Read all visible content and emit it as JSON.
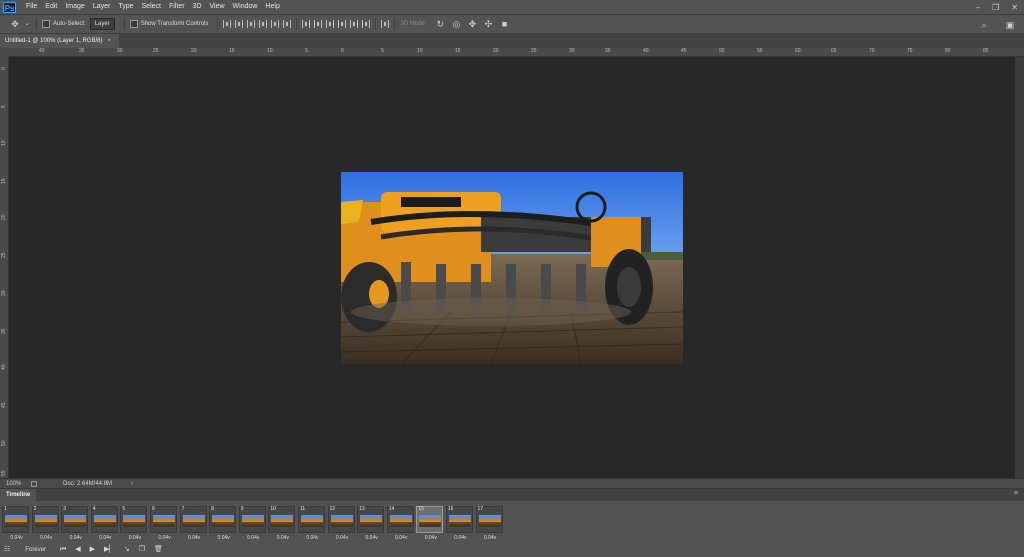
{
  "app": {
    "logo": "Ps"
  },
  "menu": [
    "File",
    "Edit",
    "Image",
    "Layer",
    "Type",
    "Select",
    "Filter",
    "3D",
    "View",
    "Window",
    "Help"
  ],
  "window_controls": [
    "minimize-icon",
    "restore-icon",
    "close-icon"
  ],
  "options": {
    "auto_select_label": "Auto-Select:",
    "auto_select_value": "Layer",
    "show_transform_label": "Show Transform Controls",
    "mode_3d_label": "3D Mode:"
  },
  "document_tab": {
    "title": "Untitled-1 @ 100% (Layer 1, RGB/8)",
    "close": "×"
  },
  "ruler_h": [
    "40",
    "35",
    "30",
    "25",
    "20",
    "15",
    "10",
    "5",
    "0",
    "5",
    "10",
    "15",
    "20",
    "25",
    "30",
    "35",
    "40",
    "45",
    "50",
    "55",
    "60",
    "65",
    "70",
    "75",
    "80",
    "85"
  ],
  "ruler_v": [
    "0",
    "5",
    "10",
    "15",
    "20",
    "25",
    "30",
    "35",
    "40",
    "45",
    "50",
    "55"
  ],
  "status": {
    "zoom": "100%",
    "doc": "Doc: 2.64M/44.8M",
    "arrow": "›"
  },
  "timeline": {
    "title": "Timeline",
    "frames": [
      {
        "n": "1",
        "d": "0.04"
      },
      {
        "n": "2",
        "d": "0.04"
      },
      {
        "n": "3",
        "d": "0.04"
      },
      {
        "n": "4",
        "d": "0.04"
      },
      {
        "n": "5",
        "d": "0.04"
      },
      {
        "n": "6",
        "d": "0.04"
      },
      {
        "n": "7",
        "d": "0.04"
      },
      {
        "n": "8",
        "d": "0.04"
      },
      {
        "n": "9",
        "d": "0.04"
      },
      {
        "n": "10",
        "d": "0.04"
      },
      {
        "n": "11",
        "d": "0.04"
      },
      {
        "n": "12",
        "d": "0.04"
      },
      {
        "n": "13",
        "d": "0.04"
      },
      {
        "n": "14",
        "d": "0.04"
      },
      {
        "n": "15",
        "d": "0.04"
      },
      {
        "n": "16",
        "d": "0.04"
      },
      {
        "n": "17",
        "d": "0.04"
      }
    ],
    "selected_frame": "15",
    "loop": "Forever",
    "delay_suffix": "v"
  }
}
